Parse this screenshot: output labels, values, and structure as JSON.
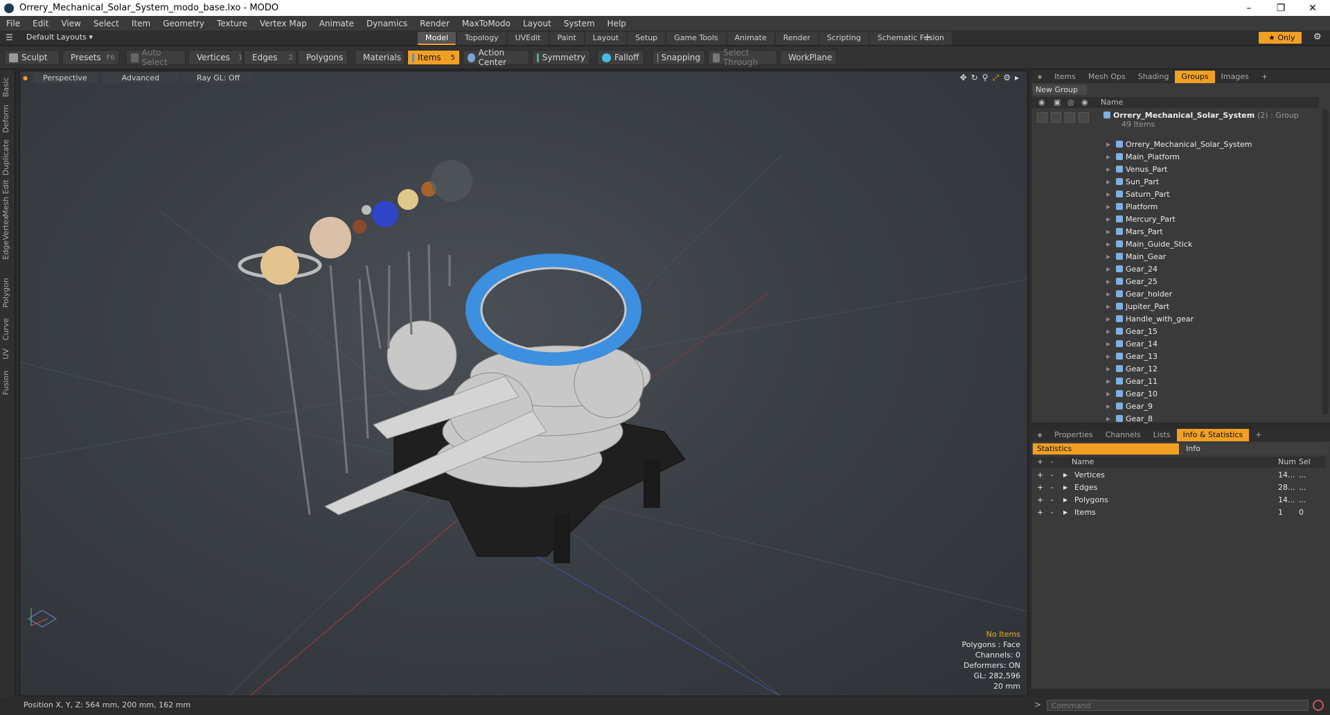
{
  "window": {
    "title": "Orrery_Mechanical_Solar_System_modo_base.lxo - MODO"
  },
  "menu": [
    "File",
    "Edit",
    "View",
    "Select",
    "Item",
    "Geometry",
    "Texture",
    "Vertex Map",
    "Animate",
    "Dynamics",
    "Render",
    "MaxToModo",
    "Layout",
    "System",
    "Help"
  ],
  "layout": {
    "name": "Default Layouts",
    "tabs": [
      "Model",
      "Topology",
      "UVEdit",
      "Paint",
      "Layout",
      "Setup",
      "Game Tools",
      "Animate",
      "Render",
      "Scripting",
      "Schematic Fusion"
    ],
    "active_tab": "Model",
    "only_label": "Only"
  },
  "toolbar": {
    "sculpt": "Sculpt",
    "presets": "Presets",
    "presets_key": "F6",
    "auto_select": "Auto Select",
    "vertices": "Vertices",
    "vertices_count": "1",
    "edges": "Edges",
    "edges_count": "2",
    "polygons": "Polygons",
    "materials": "Materials",
    "items": "Items",
    "items_count": "5",
    "action_center": "Action Center",
    "symmetry": "Symmetry",
    "falloff": "Falloff",
    "snapping": "Snapping",
    "select_through": "Select Through",
    "workplane": "WorkPlane"
  },
  "left_tabs": [
    "Basic",
    "Deform",
    "Duplicate",
    "Mesh Edit",
    "Vertex",
    "Edge",
    "Polygon",
    "Curve",
    "UV",
    "Fusion"
  ],
  "viewport": {
    "view": "Perspective",
    "shading": "Advanced",
    "raygl": "Ray GL: Off",
    "info": {
      "no_items": "No Items",
      "polygons": "Polygons : Face",
      "channels": "Channels: 0",
      "deformers": "Deformers: ON",
      "gl": "GL: 282,596",
      "scale": "20 mm"
    }
  },
  "status": {
    "position": "Position X, Y, Z:  564 mm, 200 mm, 162 mm"
  },
  "items_panel": {
    "tabs": [
      "Items",
      "Mesh Ops",
      "Shading",
      "Groups",
      "Images"
    ],
    "active_tab": "Groups",
    "new_group": "New Group",
    "col_name": "Name",
    "group": {
      "name": "Orrery_Mechanical_Solar_System",
      "suffix": "(2) : Group",
      "count": "49 Items"
    },
    "items": [
      "Orrery_Mechanical_Solar_System",
      "Main_Platform",
      "Venus_Part",
      "Sun_Part",
      "Saturn_Part",
      "Platform",
      "Mercury_Part",
      "Mars_Part",
      "Main_Guide_Stick",
      "Main_Gear",
      "Gear_24",
      "Gear_25",
      "Gear_holder",
      "Jupiter_Part",
      "Handle_with_gear",
      "Gear_15",
      "Gear_14",
      "Gear_13",
      "Gear_12",
      "Gear_11",
      "Gear_10",
      "Gear_9",
      "Gear_8"
    ]
  },
  "props_panel": {
    "tabs": [
      "Properties",
      "Channels",
      "Lists",
      "Info & Statistics"
    ],
    "active_tab": "Info & Statistics",
    "subtabs": {
      "statistics": "Statistics",
      "info": "Info"
    },
    "cols": {
      "name": "Name",
      "num": "Num",
      "sel": "Sel"
    },
    "rows": [
      {
        "name": "Vertices",
        "num": "14...",
        "sel": "..."
      },
      {
        "name": "Edges",
        "num": "28...",
        "sel": "..."
      },
      {
        "name": "Polygons",
        "num": "14...",
        "sel": "..."
      },
      {
        "name": "Items",
        "num": "1",
        "sel": "0"
      }
    ]
  },
  "command": {
    "placeholder": "Command"
  },
  "colors": {
    "accent": "#f2a024",
    "blue_ring": "#3d8fe0"
  }
}
